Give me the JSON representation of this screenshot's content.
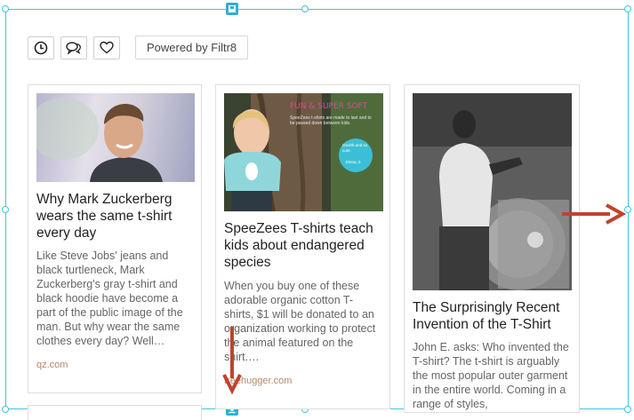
{
  "toolbar": {
    "buttons": [
      {
        "icon": "clock-icon"
      },
      {
        "icon": "speech-bubbles-icon"
      },
      {
        "icon": "heart-icon"
      }
    ],
    "powered_label": "Powered by Filtr8"
  },
  "cards": [
    {
      "title": "Why Mark Zuckerberg wears the same t-shirt every day",
      "description": "Like Steve Jobs' jeans and black turtleneck, Mark Zuckerberg's gray t-shirt and black hoodie have become a part of the public image of the man. But why wear the same clothes every day? Well…",
      "source": "qz.com"
    },
    {
      "title": "SpeeZees T-shirts teach kids about endangered species",
      "description": "When you buy one of these adorable organic cotton T-shirts, $1 will be donated to an organization working to protect the animal featured on the shirt.…",
      "source": "treehugger.com",
      "image_caption": {
        "headline": "FUN & SUPER SOFT",
        "body": "SpeeZees t-shirts are made to last and to be passed down between kids.",
        "bubble": "Ooohh and so cute.",
        "bubble_by": "Elena, 5"
      }
    },
    {
      "title": "The Surprisingly Recent Invention of the T-Shirt",
      "description": "John E. asks: Who invented the T-shirt? The t-shirt is arguably the most popular outer garment in the entire world. Coming in a range of styles,"
    }
  ],
  "colors": {
    "selection": "#3fc6e3",
    "arrow": "#c0432e",
    "source_text": "#b5886a"
  }
}
